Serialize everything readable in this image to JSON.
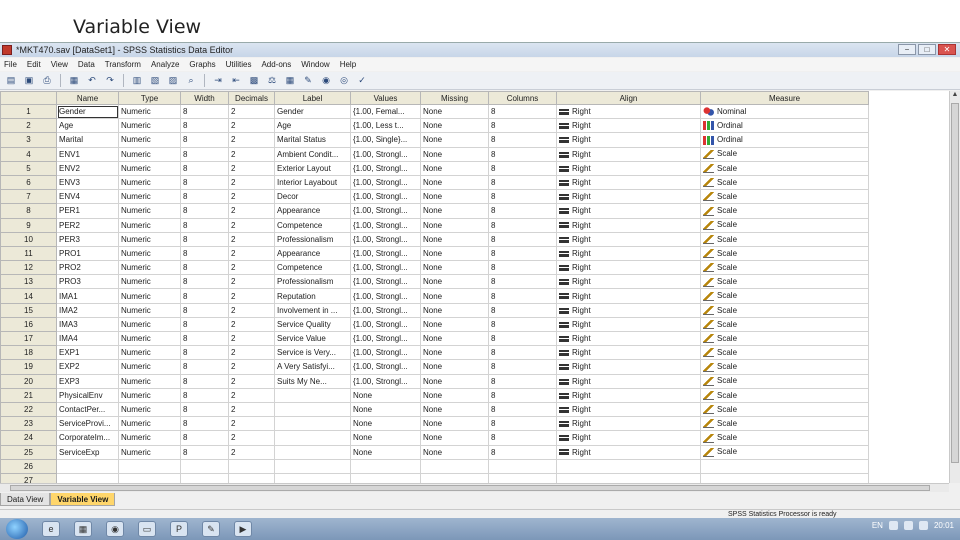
{
  "slide": {
    "title": "Variable View"
  },
  "window": {
    "title": "*MKT470.sav [DataSet1] - SPSS Statistics Data Editor",
    "controls": [
      "−",
      "□",
      "✕"
    ]
  },
  "menu": [
    "File",
    "Edit",
    "View",
    "Data",
    "Transform",
    "Analyze",
    "Graphs",
    "Utilities",
    "Add-ons",
    "Window",
    "Help"
  ],
  "toolbar_icons": [
    "open-icon",
    "save-icon",
    "print-icon",
    "dialog-recall-icon",
    "undo-icon",
    "redo-icon",
    "goto-case-icon",
    "goto-variable-icon",
    "variables-icon",
    "find-icon",
    "insert-cases-icon",
    "insert-variable-icon",
    "split-file-icon",
    "weight-cases-icon",
    "select-cases-icon",
    "value-labels-icon",
    "use-sets-icon",
    "show-all-icon",
    "spelling-icon"
  ],
  "grid": {
    "columns": [
      "Name",
      "Type",
      "Width",
      "Decimals",
      "Label",
      "Values",
      "Missing",
      "Columns",
      "Align",
      "Measure"
    ],
    "rows": [
      {
        "n": "1",
        "name": "Gender",
        "type": "Numeric",
        "width": "8",
        "dec": "2",
        "label": "Gender",
        "values": "{1.00, Femal...",
        "missing": "None",
        "columns": "8",
        "align": "Right",
        "measure": "Nominal",
        "m": "nominal"
      },
      {
        "n": "2",
        "name": "Age",
        "type": "Numeric",
        "width": "8",
        "dec": "2",
        "label": "Age",
        "values": "{1.00, Less t...",
        "missing": "None",
        "columns": "8",
        "align": "Right",
        "measure": "Ordinal",
        "m": "ordinal"
      },
      {
        "n": "3",
        "name": "Marital",
        "type": "Numeric",
        "width": "8",
        "dec": "2",
        "label": "Marital Status",
        "values": "{1.00, Single}...",
        "missing": "None",
        "columns": "8",
        "align": "Right",
        "measure": "Ordinal",
        "m": "ordinal"
      },
      {
        "n": "4",
        "name": "ENV1",
        "type": "Numeric",
        "width": "8",
        "dec": "2",
        "label": "Ambient Condit...",
        "values": "{1.00, Strongl...",
        "missing": "None",
        "columns": "8",
        "align": "Right",
        "measure": "Scale",
        "m": "scale"
      },
      {
        "n": "5",
        "name": "ENV2",
        "type": "Numeric",
        "width": "8",
        "dec": "2",
        "label": "Exterior Layout",
        "values": "{1.00, Strongl...",
        "missing": "None",
        "columns": "8",
        "align": "Right",
        "measure": "Scale",
        "m": "scale"
      },
      {
        "n": "6",
        "name": "ENV3",
        "type": "Numeric",
        "width": "8",
        "dec": "2",
        "label": "Interior Layabout",
        "values": "{1.00, Strongl...",
        "missing": "None",
        "columns": "8",
        "align": "Right",
        "measure": "Scale",
        "m": "scale"
      },
      {
        "n": "7",
        "name": "ENV4",
        "type": "Numeric",
        "width": "8",
        "dec": "2",
        "label": "Decor",
        "values": "{1.00, Strongl...",
        "missing": "None",
        "columns": "8",
        "align": "Right",
        "measure": "Scale",
        "m": "scale"
      },
      {
        "n": "8",
        "name": "PER1",
        "type": "Numeric",
        "width": "8",
        "dec": "2",
        "label": "Appearance",
        "values": "{1.00, Strongl...",
        "missing": "None",
        "columns": "8",
        "align": "Right",
        "measure": "Scale",
        "m": "scale"
      },
      {
        "n": "9",
        "name": "PER2",
        "type": "Numeric",
        "width": "8",
        "dec": "2",
        "label": "Competence",
        "values": "{1.00, Strongl...",
        "missing": "None",
        "columns": "8",
        "align": "Right",
        "measure": "Scale",
        "m": "scale"
      },
      {
        "n": "10",
        "name": "PER3",
        "type": "Numeric",
        "width": "8",
        "dec": "2",
        "label": "Professionalism",
        "values": "{1.00, Strongl...",
        "missing": "None",
        "columns": "8",
        "align": "Right",
        "measure": "Scale",
        "m": "scale"
      },
      {
        "n": "11",
        "name": "PRO1",
        "type": "Numeric",
        "width": "8",
        "dec": "2",
        "label": "Appearance",
        "values": "{1.00, Strongl...",
        "missing": "None",
        "columns": "8",
        "align": "Right",
        "measure": "Scale",
        "m": "scale"
      },
      {
        "n": "12",
        "name": "PRO2",
        "type": "Numeric",
        "width": "8",
        "dec": "2",
        "label": "Competence",
        "values": "{1.00, Strongl...",
        "missing": "None",
        "columns": "8",
        "align": "Right",
        "measure": "Scale",
        "m": "scale"
      },
      {
        "n": "13",
        "name": "PRO3",
        "type": "Numeric",
        "width": "8",
        "dec": "2",
        "label": "Professionalism",
        "values": "{1.00, Strongl...",
        "missing": "None",
        "columns": "8",
        "align": "Right",
        "measure": "Scale",
        "m": "scale"
      },
      {
        "n": "14",
        "name": "IMA1",
        "type": "Numeric",
        "width": "8",
        "dec": "2",
        "label": "Reputation",
        "values": "{1.00, Strongl...",
        "missing": "None",
        "columns": "8",
        "align": "Right",
        "measure": "Scale",
        "m": "scale"
      },
      {
        "n": "15",
        "name": "IMA2",
        "type": "Numeric",
        "width": "8",
        "dec": "2",
        "label": "Involvement in ...",
        "values": "{1.00, Strongl...",
        "missing": "None",
        "columns": "8",
        "align": "Right",
        "measure": "Scale",
        "m": "scale"
      },
      {
        "n": "16",
        "name": "IMA3",
        "type": "Numeric",
        "width": "8",
        "dec": "2",
        "label": "Service Quality",
        "values": "{1.00, Strongl...",
        "missing": "None",
        "columns": "8",
        "align": "Right",
        "measure": "Scale",
        "m": "scale"
      },
      {
        "n": "17",
        "name": "IMA4",
        "type": "Numeric",
        "width": "8",
        "dec": "2",
        "label": "Service Value",
        "values": "{1.00, Strongl...",
        "missing": "None",
        "columns": "8",
        "align": "Right",
        "measure": "Scale",
        "m": "scale"
      },
      {
        "n": "18",
        "name": "EXP1",
        "type": "Numeric",
        "width": "8",
        "dec": "2",
        "label": "Service is Very...",
        "values": "{1.00, Strongl...",
        "missing": "None",
        "columns": "8",
        "align": "Right",
        "measure": "Scale",
        "m": "scale"
      },
      {
        "n": "19",
        "name": "EXP2",
        "type": "Numeric",
        "width": "8",
        "dec": "2",
        "label": "A Very Satisfyi...",
        "values": "{1.00, Strongl...",
        "missing": "None",
        "columns": "8",
        "align": "Right",
        "measure": "Scale",
        "m": "scale"
      },
      {
        "n": "20",
        "name": "EXP3",
        "type": "Numeric",
        "width": "8",
        "dec": "2",
        "label": "Suits My Ne...",
        "values": "{1.00, Strongl...",
        "missing": "None",
        "columns": "8",
        "align": "Right",
        "measure": "Scale",
        "m": "scale"
      },
      {
        "n": "21",
        "name": "PhysicalEnv",
        "type": "Numeric",
        "width": "8",
        "dec": "2",
        "label": "",
        "values": "None",
        "missing": "None",
        "columns": "8",
        "align": "Right",
        "measure": "Scale",
        "m": "scale"
      },
      {
        "n": "22",
        "name": "ContactPer...",
        "type": "Numeric",
        "width": "8",
        "dec": "2",
        "label": "",
        "values": "None",
        "missing": "None",
        "columns": "8",
        "align": "Right",
        "measure": "Scale",
        "m": "scale"
      },
      {
        "n": "23",
        "name": "ServiceProvi...",
        "type": "Numeric",
        "width": "8",
        "dec": "2",
        "label": "",
        "values": "None",
        "missing": "None",
        "columns": "8",
        "align": "Right",
        "measure": "Scale",
        "m": "scale"
      },
      {
        "n": "24",
        "name": "CorporateIm...",
        "type": "Numeric",
        "width": "8",
        "dec": "2",
        "label": "",
        "values": "None",
        "missing": "None",
        "columns": "8",
        "align": "Right",
        "measure": "Scale",
        "m": "scale"
      },
      {
        "n": "25",
        "name": "ServiceExp",
        "type": "Numeric",
        "width": "8",
        "dec": "2",
        "label": "",
        "values": "None",
        "missing": "None",
        "columns": "8",
        "align": "Right",
        "measure": "Scale",
        "m": "scale"
      },
      {
        "n": "26",
        "name": "",
        "type": "",
        "width": "",
        "dec": "",
        "label": "",
        "values": "",
        "missing": "",
        "columns": "",
        "align": "",
        "measure": "",
        "m": ""
      },
      {
        "n": "27",
        "name": "",
        "type": "",
        "width": "",
        "dec": "",
        "label": "",
        "values": "",
        "missing": "",
        "columns": "",
        "align": "",
        "measure": "",
        "m": ""
      }
    ]
  },
  "tabs": [
    {
      "label": "Data View",
      "active": false
    },
    {
      "label": "Variable View",
      "active": true
    }
  ],
  "status": {
    "text": "SPSS Statistics  Processor is ready"
  },
  "taskbar": {
    "language": "EN",
    "time": "20:01",
    "apps": [
      "ie-icon",
      "spss-icon",
      "firefox-icon",
      "folder-icon",
      "powerpoint-icon",
      "paint-icon",
      "pdf-icon"
    ]
  }
}
